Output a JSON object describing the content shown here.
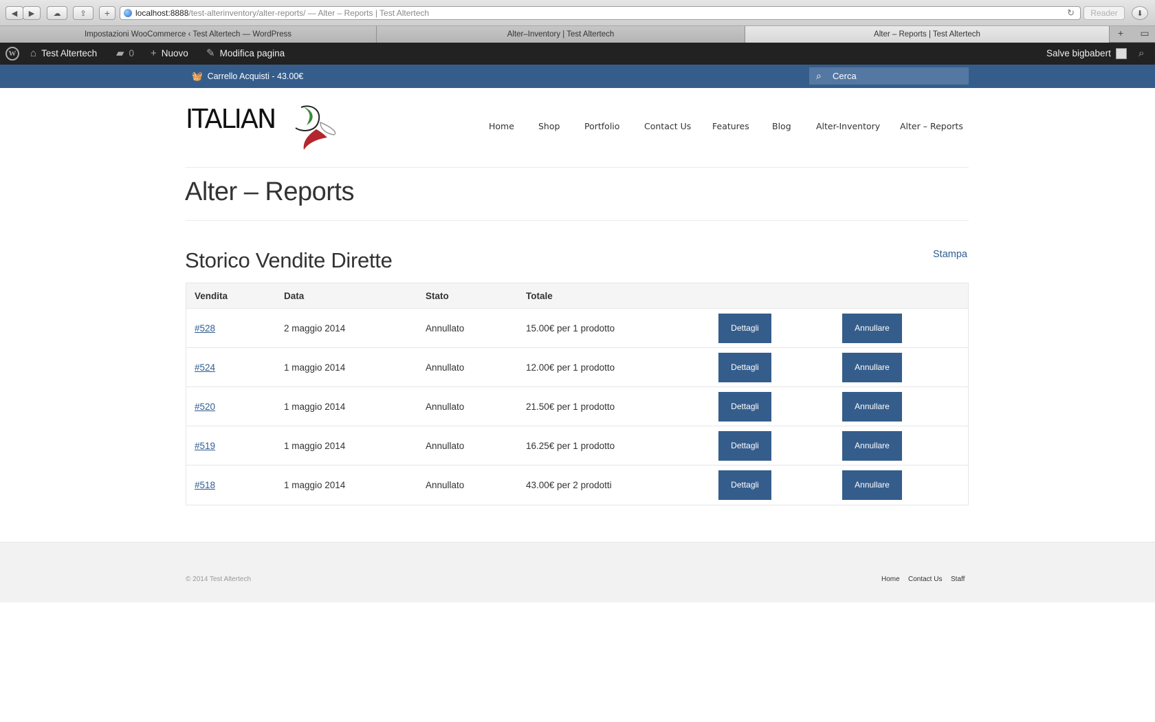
{
  "browser": {
    "url_host": "localhost:8888",
    "url_rest": "/test-alterinventory/alter-reports/ — Alter – Reports | Test Altertech",
    "reader_label": "Reader",
    "tabs": [
      {
        "label": "Impostazioni WooCommerce ‹ Test Altertech — WordPress",
        "active": false
      },
      {
        "label": "Alter–Inventory | Test Altertech",
        "active": false
      },
      {
        "label": "Alter – Reports | Test Altertech",
        "active": true
      }
    ]
  },
  "adminbar": {
    "site_name": "Test Altertech",
    "comments_count": "0",
    "new_label": "Nuovo",
    "edit_label": "Modifica pagina",
    "greeting": "Salve bigbabert"
  },
  "storebar": {
    "cart_label": "Carrello Acquisti - 43.00€",
    "search_placeholder": "Cerca"
  },
  "site": {
    "logo_text": "ITALIAN"
  },
  "nav": {
    "items": [
      "Home",
      "Shop",
      "Portfolio",
      "Contact Us",
      "Features",
      "Blog",
      "Alter-Inventory",
      "Alter – Reports"
    ]
  },
  "page": {
    "title": "Alter – Reports",
    "section_title": "Storico Vendite Dirette",
    "print_label": "Stampa"
  },
  "table": {
    "headers": [
      "Vendita",
      "Data",
      "Stato",
      "Totale"
    ],
    "details_label": "Dettagli",
    "cancel_label": "Annullare",
    "rows": [
      {
        "id": "#528",
        "date": "2 maggio 2014",
        "status": "Annullato",
        "total": "15.00€ per 1 prodotto"
      },
      {
        "id": "#524",
        "date": "1 maggio 2014",
        "status": "Annullato",
        "total": "12.00€ per 1 prodotto"
      },
      {
        "id": "#520",
        "date": "1 maggio 2014",
        "status": "Annullato",
        "total": "21.50€ per 1 prodotto"
      },
      {
        "id": "#519",
        "date": "1 maggio 2014",
        "status": "Annullato",
        "total": "16.25€ per 1 prodotto"
      },
      {
        "id": "#518",
        "date": "1 maggio 2014",
        "status": "Annullato",
        "total": "43.00€ per 2 prodotti"
      }
    ]
  },
  "footer": {
    "copyright": "© 2014 Test Altertech",
    "links": [
      "Home",
      "Contact Us",
      "Staff"
    ]
  },
  "colors": {
    "accent": "#355d8c",
    "link": "#2f5d91",
    "adminbar": "#222222"
  }
}
